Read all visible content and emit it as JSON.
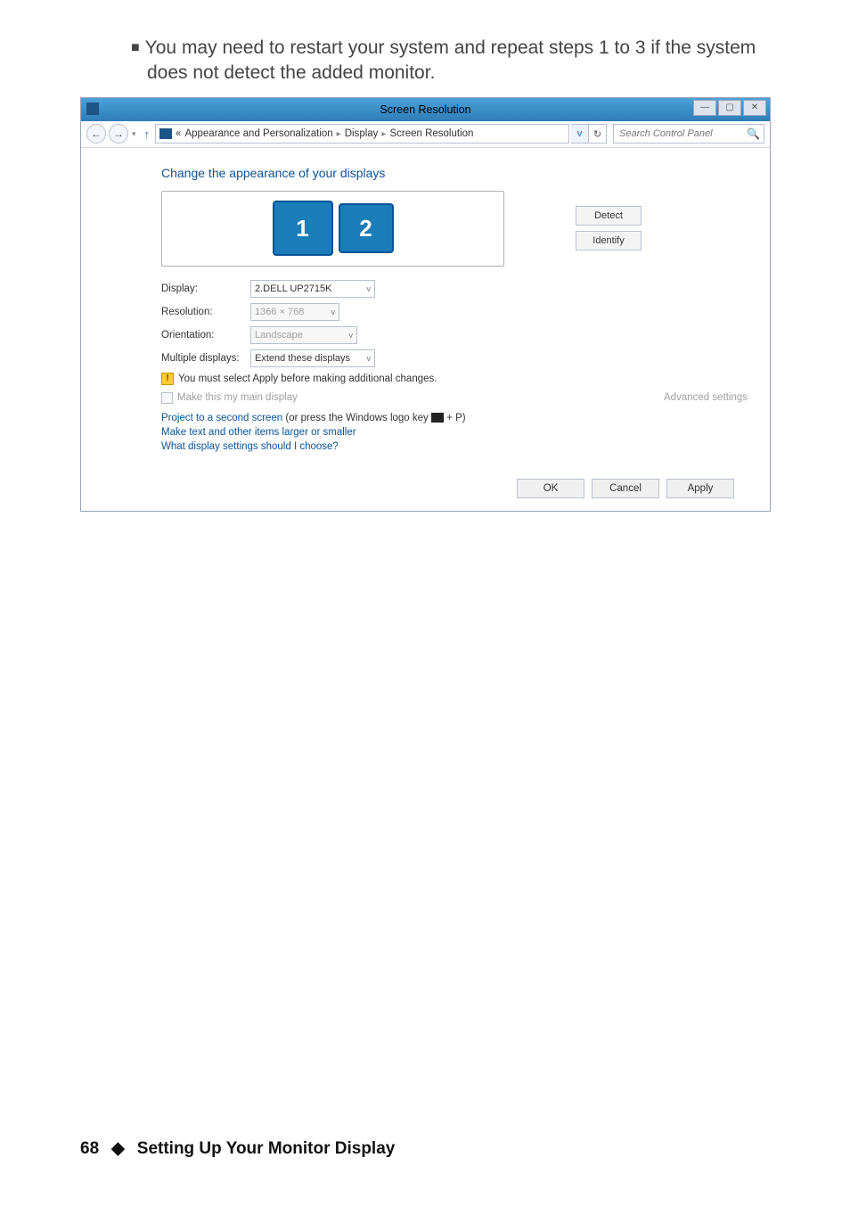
{
  "instruction": "You may need to restart your system and repeat steps 1 to 3 if the system does not detect the added monitor.",
  "window": {
    "title": "Screen Resolution",
    "breadcrumb": {
      "chevron": "«",
      "part1": "Appearance and Personalization",
      "part2": "Display",
      "part3": "Screen Resolution"
    },
    "addr_dropdown": "v",
    "refresh": "↻",
    "search_placeholder": "Search Control Panel"
  },
  "content": {
    "heading": "Change the appearance of your displays",
    "monitor1": "1",
    "monitor2": "2",
    "detect": "Detect",
    "identify": "Identify",
    "labels": {
      "display": "Display:",
      "resolution": "Resolution:",
      "orientation": "Orientation:",
      "multiple": "Multiple displays:"
    },
    "values": {
      "display": "2.DELL UP2715K",
      "resolution": "1366 × 768",
      "orientation": "Landscape",
      "multiple": "Extend these displays"
    },
    "warning": "You must select Apply before making additional changes.",
    "make_main": "Make this my main display",
    "advanced": "Advanced settings",
    "line1a": "Project to a second screen",
    "line1b": " (or press the Windows logo key ",
    "line1c": " + P)",
    "line2": "Make text and other items larger or smaller",
    "line3": "What display settings should I choose?",
    "ok": "OK",
    "cancel": "Cancel",
    "apply": "Apply"
  },
  "footer": {
    "page": "68",
    "title": "Setting Up Your Monitor Display"
  }
}
